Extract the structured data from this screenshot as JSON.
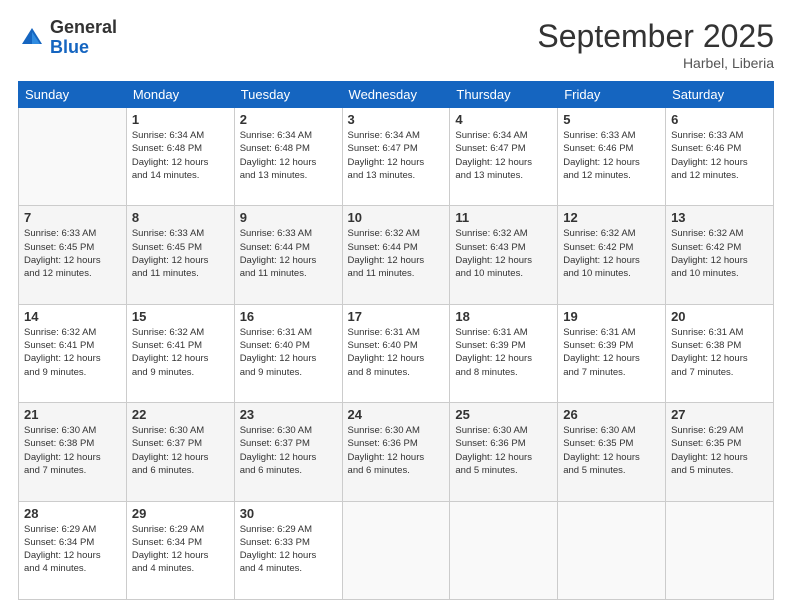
{
  "logo": {
    "general": "General",
    "blue": "Blue"
  },
  "title": "September 2025",
  "location": "Harbel, Liberia",
  "days_of_week": [
    "Sunday",
    "Monday",
    "Tuesday",
    "Wednesday",
    "Thursday",
    "Friday",
    "Saturday"
  ],
  "weeks": [
    [
      {
        "day": "",
        "info": ""
      },
      {
        "day": "1",
        "info": "Sunrise: 6:34 AM\nSunset: 6:48 PM\nDaylight: 12 hours\nand 14 minutes."
      },
      {
        "day": "2",
        "info": "Sunrise: 6:34 AM\nSunset: 6:48 PM\nDaylight: 12 hours\nand 13 minutes."
      },
      {
        "day": "3",
        "info": "Sunrise: 6:34 AM\nSunset: 6:47 PM\nDaylight: 12 hours\nand 13 minutes."
      },
      {
        "day": "4",
        "info": "Sunrise: 6:34 AM\nSunset: 6:47 PM\nDaylight: 12 hours\nand 13 minutes."
      },
      {
        "day": "5",
        "info": "Sunrise: 6:33 AM\nSunset: 6:46 PM\nDaylight: 12 hours\nand 12 minutes."
      },
      {
        "day": "6",
        "info": "Sunrise: 6:33 AM\nSunset: 6:46 PM\nDaylight: 12 hours\nand 12 minutes."
      }
    ],
    [
      {
        "day": "7",
        "info": "Sunrise: 6:33 AM\nSunset: 6:45 PM\nDaylight: 12 hours\nand 12 minutes."
      },
      {
        "day": "8",
        "info": "Sunrise: 6:33 AM\nSunset: 6:45 PM\nDaylight: 12 hours\nand 11 minutes."
      },
      {
        "day": "9",
        "info": "Sunrise: 6:33 AM\nSunset: 6:44 PM\nDaylight: 12 hours\nand 11 minutes."
      },
      {
        "day": "10",
        "info": "Sunrise: 6:32 AM\nSunset: 6:44 PM\nDaylight: 12 hours\nand 11 minutes."
      },
      {
        "day": "11",
        "info": "Sunrise: 6:32 AM\nSunset: 6:43 PM\nDaylight: 12 hours\nand 10 minutes."
      },
      {
        "day": "12",
        "info": "Sunrise: 6:32 AM\nSunset: 6:42 PM\nDaylight: 12 hours\nand 10 minutes."
      },
      {
        "day": "13",
        "info": "Sunrise: 6:32 AM\nSunset: 6:42 PM\nDaylight: 12 hours\nand 10 minutes."
      }
    ],
    [
      {
        "day": "14",
        "info": "Sunrise: 6:32 AM\nSunset: 6:41 PM\nDaylight: 12 hours\nand 9 minutes."
      },
      {
        "day": "15",
        "info": "Sunrise: 6:32 AM\nSunset: 6:41 PM\nDaylight: 12 hours\nand 9 minutes."
      },
      {
        "day": "16",
        "info": "Sunrise: 6:31 AM\nSunset: 6:40 PM\nDaylight: 12 hours\nand 9 minutes."
      },
      {
        "day": "17",
        "info": "Sunrise: 6:31 AM\nSunset: 6:40 PM\nDaylight: 12 hours\nand 8 minutes."
      },
      {
        "day": "18",
        "info": "Sunrise: 6:31 AM\nSunset: 6:39 PM\nDaylight: 12 hours\nand 8 minutes."
      },
      {
        "day": "19",
        "info": "Sunrise: 6:31 AM\nSunset: 6:39 PM\nDaylight: 12 hours\nand 7 minutes."
      },
      {
        "day": "20",
        "info": "Sunrise: 6:31 AM\nSunset: 6:38 PM\nDaylight: 12 hours\nand 7 minutes."
      }
    ],
    [
      {
        "day": "21",
        "info": "Sunrise: 6:30 AM\nSunset: 6:38 PM\nDaylight: 12 hours\nand 7 minutes."
      },
      {
        "day": "22",
        "info": "Sunrise: 6:30 AM\nSunset: 6:37 PM\nDaylight: 12 hours\nand 6 minutes."
      },
      {
        "day": "23",
        "info": "Sunrise: 6:30 AM\nSunset: 6:37 PM\nDaylight: 12 hours\nand 6 minutes."
      },
      {
        "day": "24",
        "info": "Sunrise: 6:30 AM\nSunset: 6:36 PM\nDaylight: 12 hours\nand 6 minutes."
      },
      {
        "day": "25",
        "info": "Sunrise: 6:30 AM\nSunset: 6:36 PM\nDaylight: 12 hours\nand 5 minutes."
      },
      {
        "day": "26",
        "info": "Sunrise: 6:30 AM\nSunset: 6:35 PM\nDaylight: 12 hours\nand 5 minutes."
      },
      {
        "day": "27",
        "info": "Sunrise: 6:29 AM\nSunset: 6:35 PM\nDaylight: 12 hours\nand 5 minutes."
      }
    ],
    [
      {
        "day": "28",
        "info": "Sunrise: 6:29 AM\nSunset: 6:34 PM\nDaylight: 12 hours\nand 4 minutes."
      },
      {
        "day": "29",
        "info": "Sunrise: 6:29 AM\nSunset: 6:34 PM\nDaylight: 12 hours\nand 4 minutes."
      },
      {
        "day": "30",
        "info": "Sunrise: 6:29 AM\nSunset: 6:33 PM\nDaylight: 12 hours\nand 4 minutes."
      },
      {
        "day": "",
        "info": ""
      },
      {
        "day": "",
        "info": ""
      },
      {
        "day": "",
        "info": ""
      },
      {
        "day": "",
        "info": ""
      }
    ]
  ]
}
